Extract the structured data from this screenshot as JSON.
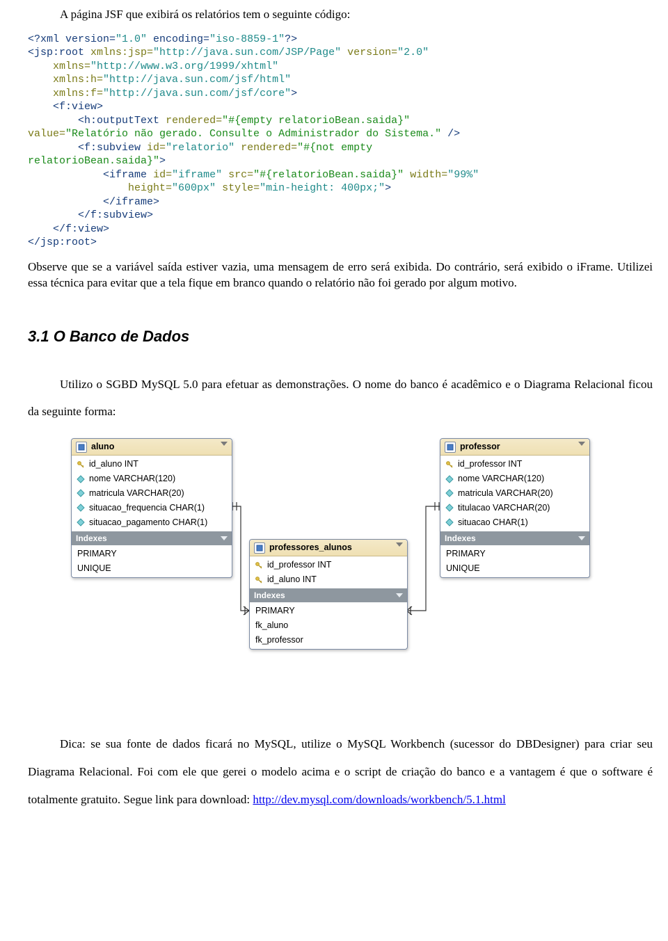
{
  "intro": "A página JSF que exibirá os relatórios tem o seguinte código:",
  "observe": "Observe que se a variável saída estiver vazia, uma mensagem de erro será exibida. Do contrário, será exibido o iFrame. Utilizei essa técnica para evitar que a tela fique em branco quando o relatório não foi gerado por algum motivo.",
  "section_title": "3.1  O Banco de Dados",
  "body_before_diagram": "Utilizo o SGBD MySQL 5.0 para efetuar as demonstrações. O nome do banco é acadêmico e o Diagrama Relacional ficou da seguinte forma:",
  "tip_before_link": "Dica: se sua fonte de dados ficará no MySQL, utilize o MySQL Workbench (sucessor do DBDesigner) para criar seu Diagrama Relacional. Foi com ele que gerei o modelo acima e o script de criação do banco e a vantagem é que o software é totalmente gratuito.  Segue link para download: ",
  "download_link": "http://dev.mysql.com/downloads/workbench/5.1.html",
  "code": {
    "l1a": "<?xml version=",
    "l1b": "\"1.0\"",
    "l1c": " encoding=",
    "l1d": "\"iso-8859-1\"",
    "l1e": "?>",
    "l2a": "<jsp:root",
    "l2b": "xmlns:jsp=",
    "l2c": "\"http://java.sun.com/JSP/Page\"",
    "l2d": "version=",
    "l2e": "\"2.0\"",
    "l3a": "xmlns=",
    "l3b": "\"http://www.w3.org/1999/xhtml\"",
    "l4a": "xmlns:h=",
    "l4b": "\"http://java.sun.com/jsf/html\"",
    "l5a": "xmlns:f=",
    "l5b": "\"http://java.sun.com/jsf/core\"",
    "l5c": ">",
    "l6": "<f:view>",
    "l7a": "<h:outputText",
    "l7b": "rendered=",
    "l7c": "\"#{empty relatorioBean.saida}\"",
    "l8a": "value=",
    "l8b": "\"Relatório não gerado. Consulte o Administrador do Sistema.\"",
    "l8c": " />",
    "l9a": "<f:subview",
    "l9b": "id=",
    "l9c": "\"relatorio\"",
    "l9d": "rendered=",
    "l9e": "\"#{not empty",
    "l10a": "relatorioBean.saida}\"",
    "l10b": ">",
    "l11a": "<iframe",
    "l11b": "id=",
    "l11c": "\"iframe\"",
    "l11d": "src=",
    "l11e": "\"#{relatorioBean.saida}\"",
    "l11f": "width=",
    "l11g": "\"99%\"",
    "l12a": "height=",
    "l12b": "\"600px\"",
    "l12c": "style=",
    "l12d": "\"min-height: 400px;\"",
    "l12e": ">",
    "l13": "</iframe>",
    "l14": "</f:subview>",
    "l15": "</f:view>",
    "l16": "</jsp:root>"
  },
  "diagram": {
    "indexes_label": "Indexes",
    "aluno": {
      "title": "aluno",
      "cols": [
        "id_aluno INT",
        "nome VARCHAR(120)",
        "matricula VARCHAR(20)",
        "situacao_frequencia CHAR(1)",
        "situacao_pagamento CHAR(1)"
      ],
      "idx": [
        "PRIMARY",
        "UNIQUE"
      ]
    },
    "professor": {
      "title": "professor",
      "cols": [
        "id_professor INT",
        "nome VARCHAR(120)",
        "matricula VARCHAR(20)",
        "titulacao VARCHAR(20)",
        "situacao CHAR(1)"
      ],
      "idx": [
        "PRIMARY",
        "UNIQUE"
      ]
    },
    "junc": {
      "title": "professores_alunos",
      "cols": [
        "id_professor INT",
        "id_aluno INT"
      ],
      "idx": [
        "PRIMARY",
        "fk_aluno",
        "fk_professor"
      ]
    }
  }
}
